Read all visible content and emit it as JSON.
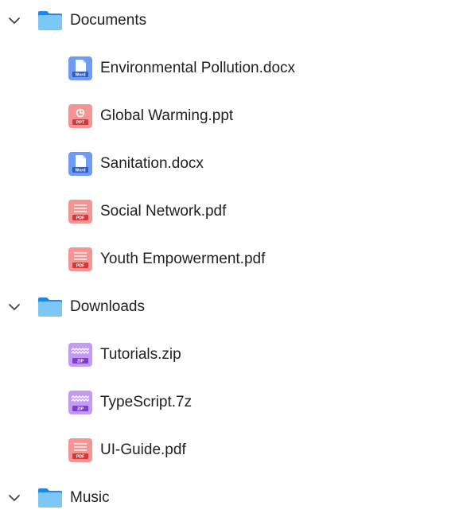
{
  "tree": {
    "folders": [
      {
        "label": "Documents",
        "expanded": true,
        "files": [
          {
            "label": "Environmental Pollution.docx",
            "type": "word",
            "badge": "Word"
          },
          {
            "label": "Global Warming.ppt",
            "type": "ppt",
            "badge": "PPT"
          },
          {
            "label": "Sanitation.docx",
            "type": "word",
            "badge": "Word"
          },
          {
            "label": "Social Network.pdf",
            "type": "pdf",
            "badge": "PDF"
          },
          {
            "label": "Youth Empowerment.pdf",
            "type": "pdf",
            "badge": "PDF"
          }
        ]
      },
      {
        "label": "Downloads",
        "expanded": true,
        "files": [
          {
            "label": "Tutorials.zip",
            "type": "zip",
            "badge": "ZIP"
          },
          {
            "label": "TypeScript.7z",
            "type": "zip",
            "badge": "ZIP"
          },
          {
            "label": "UI-Guide.pdf",
            "type": "pdf",
            "badge": "PDF"
          }
        ]
      },
      {
        "label": "Music",
        "expanded": true,
        "files": []
      }
    ]
  },
  "colors": {
    "folder_body": "#7cc8f5",
    "folder_tab": "#1e88e5",
    "word": "#6f9cf2",
    "word_dark": "#2e5bbf",
    "ppt": "#f49595",
    "ppt_dark": "#cf3b3b",
    "pdf": "#f49595",
    "pdf_dark": "#cf3b3b",
    "zip": "#c49af3",
    "zip_dark": "#7b3fd1",
    "chevron": "#424242",
    "text": "#212121"
  }
}
